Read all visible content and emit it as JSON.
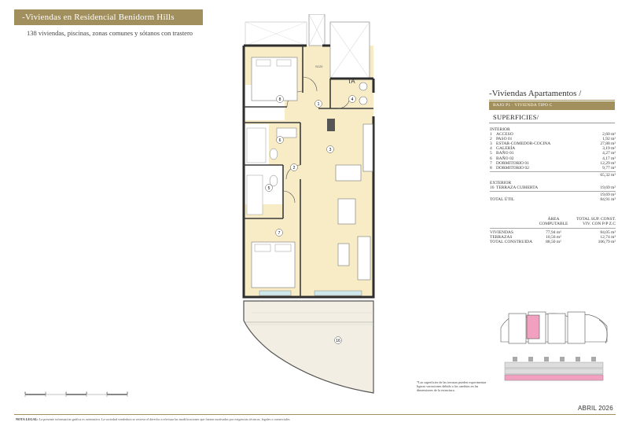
{
  "header": {
    "title": "-Viviendas en Residencial Benidorm Hills"
  },
  "intro": {
    "text": "138 viviendas, piscinas, zonas comunes y sótanos con trastero"
  },
  "unit": {
    "section_title": "-Viviendas Apartamentos /",
    "subtitle": "BAJO P1 · VIVIENDA TIPO C",
    "surfaces_title": "SUPERFICIES/"
  },
  "surfaces": {
    "interior_label": "INTERIOR",
    "interior": [
      {
        "n": "1",
        "name": "ACCESO",
        "area": "2,60 m²"
      },
      {
        "n": "2",
        "name": "PASO 01",
        "area": "1,92 m²"
      },
      {
        "n": "3",
        "name": "ESTAR-COMEDOR-COCINA",
        "area": "27,88 m²"
      },
      {
        "n": "4",
        "name": "GALERÍA",
        "area": "3,19 m²"
      },
      {
        "n": "5",
        "name": "BAÑO 01",
        "area": "4,27 m²"
      },
      {
        "n": "6",
        "name": "BAÑO 02",
        "area": "4,17 m²"
      },
      {
        "n": "7",
        "name": "DORMITORIO 01",
        "area": "12,29 m²"
      },
      {
        "n": "8",
        "name": "DORMITORIO 02",
        "area": "9,77 m²"
      }
    ],
    "interior_total": "65,32 m²",
    "exterior_label": "EXTERIOR",
    "exterior": [
      {
        "n": "16",
        "name": "TERRAZA CUBIERTA",
        "area": "19,69 m²"
      }
    ],
    "exterior_total": "19,69 m²",
    "total_label": "TOTAL ÚTIL",
    "total": "84,91 m²"
  },
  "summary": {
    "col1": "ÁREA COMPUTABLE",
    "col2": "TOTAL SUP. CONST. VIV. CON P/P Z.C",
    "rows": [
      {
        "label": "VIVIENDAS",
        "a": "77,94 m²",
        "b": "84,05 m²"
      },
      {
        "label": "TERRAZAS",
        "a": "10,56 m²",
        "b": "12,74 m²"
      },
      {
        "label": "TOTAL CONSTRUIDA",
        "a": "88,50 m²",
        "b": "106,79 m²"
      }
    ]
  },
  "plan": {
    "room_numbers": [
      "1",
      "2",
      "3",
      "4",
      "5",
      "6",
      "7",
      "8",
      "16"
    ],
    "tag_text": "TA",
    "door_label": "S120"
  },
  "scale": {
    "labels": [
      "0",
      "1",
      "2",
      "3",
      "4",
      "5"
    ]
  },
  "footnote": "*Las superficies de las terrazas pueden experimentar ligeras variaciones debido a los cambios en las dimensiones de la estructura.",
  "date": "ABRIL 2026",
  "legal": {
    "label": "NOTA LEGAL:",
    "text": "La presente información gráfica es orientativa. La sociedad vendedora se reserva el derecho a efectuar las modificaciones que fuesen motivadas por exigencias técnicas, legales o comerciales."
  },
  "colors": {
    "accent": "#a28f5e",
    "floor": "#f7ecc6",
    "highlight": "#f2a0c0"
  }
}
